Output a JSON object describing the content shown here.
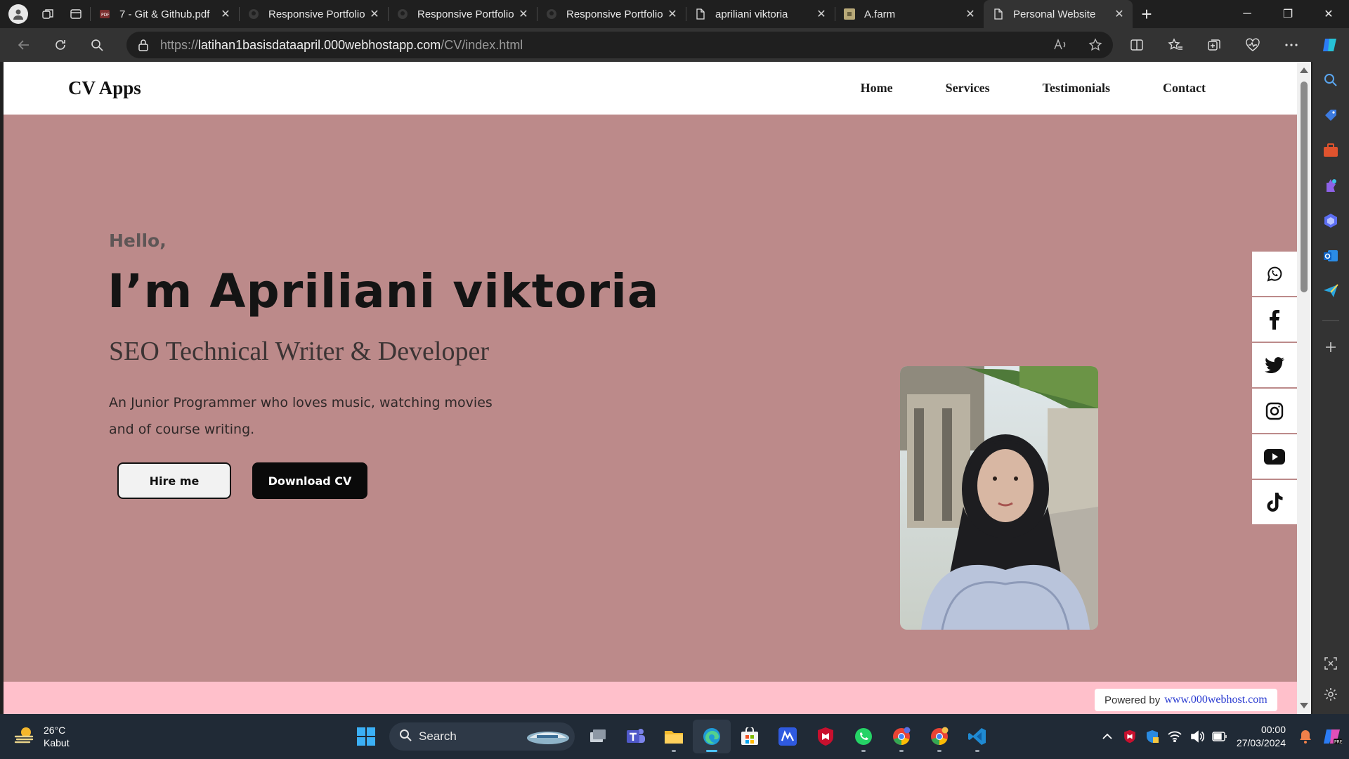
{
  "browser": {
    "tabs": [
      {
        "title": "7 - Git & Github.pdf",
        "icon": "pdf-icon",
        "active": false
      },
      {
        "title": "Responsive Portfolio",
        "icon": "github-icon",
        "active": false
      },
      {
        "title": "Responsive Portfolio",
        "icon": "github-icon",
        "active": false
      },
      {
        "title": "Responsive Portfolio",
        "icon": "github-icon",
        "active": false
      },
      {
        "title": "apriliani viktoria",
        "icon": "page-icon",
        "active": false
      },
      {
        "title": "A.farm",
        "icon": "farm-favicon",
        "active": false
      },
      {
        "title": "Personal Website",
        "icon": "page-icon",
        "active": true
      }
    ],
    "url": {
      "scheme": "https://",
      "host": "latihan1basisdataapril.000webhostapp.com",
      "path": "/CV/index.html"
    }
  },
  "site": {
    "brand": "CV Apps",
    "nav": [
      "Home",
      "Services",
      "Testimonials",
      "Contact"
    ],
    "hero": {
      "greeting": "Hello,",
      "name": "I’m Apriliani viktoria",
      "role": "SEO Technical Writer & Developer",
      "description": "An Junior Programmer who loves music, watching movies and of course writing.",
      "hire_label": "Hire me",
      "download_label": "Download CV"
    },
    "social": [
      "whatsapp-icon",
      "facebook-icon",
      "twitter-icon",
      "instagram-icon",
      "youtube-icon",
      "tiktok-icon"
    ],
    "colors": {
      "hero_bg": "#bc8a8a",
      "footer_band": "#ffc0cb"
    },
    "powered": {
      "prefix": "Powered by",
      "brand": "www.000webhost.com"
    }
  },
  "taskbar": {
    "weather": {
      "temp": "26°C",
      "condition": "Kabut"
    },
    "search_placeholder": "Search",
    "clock": {
      "time": "00:00",
      "date": "27/03/2024"
    }
  }
}
